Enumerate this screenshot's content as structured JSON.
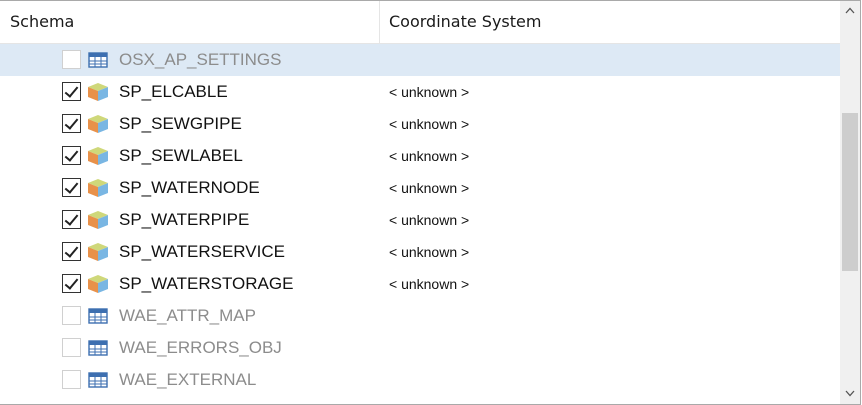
{
  "columns": {
    "schema": "Schema",
    "coordinate_system": "Coordinate System"
  },
  "rows": [
    {
      "name": "OSX_AP_SETTINGS",
      "coord": "",
      "checked": false,
      "enabled": false,
      "icon": "table-icon",
      "selected": true
    },
    {
      "name": "SP_ELCABLE",
      "coord": "< unknown >",
      "checked": true,
      "enabled": true,
      "icon": "feature-class-icon",
      "selected": false
    },
    {
      "name": "SP_SEWGPIPE",
      "coord": "< unknown >",
      "checked": true,
      "enabled": true,
      "icon": "feature-class-icon",
      "selected": false
    },
    {
      "name": "SP_SEWLABEL",
      "coord": "< unknown >",
      "checked": true,
      "enabled": true,
      "icon": "feature-class-icon",
      "selected": false
    },
    {
      "name": "SP_WATERNODE",
      "coord": "< unknown >",
      "checked": true,
      "enabled": true,
      "icon": "feature-class-icon",
      "selected": false
    },
    {
      "name": "SP_WATERPIPE",
      "coord": "< unknown >",
      "checked": true,
      "enabled": true,
      "icon": "feature-class-icon",
      "selected": false
    },
    {
      "name": "SP_WATERSERVICE",
      "coord": "< unknown >",
      "checked": true,
      "enabled": true,
      "icon": "feature-class-icon",
      "selected": false
    },
    {
      "name": "SP_WATERSTORAGE",
      "coord": "< unknown >",
      "checked": true,
      "enabled": true,
      "icon": "feature-class-icon",
      "selected": false
    },
    {
      "name": "WAE_ATTR_MAP",
      "coord": "",
      "checked": false,
      "enabled": false,
      "icon": "table-icon",
      "selected": false
    },
    {
      "name": "WAE_ERRORS_OBJ",
      "coord": "",
      "checked": false,
      "enabled": false,
      "icon": "table-icon",
      "selected": false
    },
    {
      "name": "WAE_EXTERNAL",
      "coord": "",
      "checked": false,
      "enabled": false,
      "icon": "table-icon",
      "selected": false
    }
  ],
  "icons": {
    "scroll_up": "chevron-up-icon",
    "scroll_down": "chevron-down-icon"
  },
  "colors": {
    "selection": "#dde9f5",
    "disabled_text": "#8c8c8c",
    "cube_top": "#cfd87a",
    "cube_left": "#e8914a",
    "cube_right": "#79b6e3",
    "table_icon": "#3d6fb0"
  }
}
